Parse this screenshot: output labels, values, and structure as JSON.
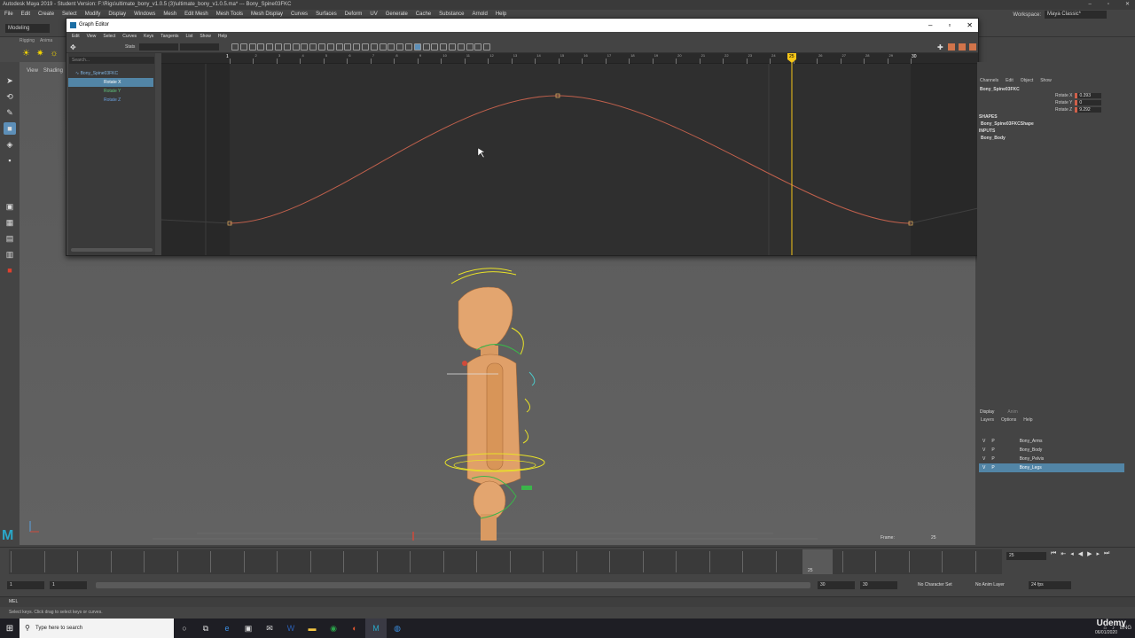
{
  "app": {
    "title": "Autodesk Maya 2019 - Student Version: F:\\Rigs\\ultimate_bony_v1.0.5 (3)\\ultimate_bony_v1.0.5.ma* --- Bony_Spine03FKC",
    "menus": [
      "File",
      "Edit",
      "Create",
      "Select",
      "Modify",
      "Display",
      "Windows",
      "Mesh",
      "Edit Mesh",
      "Mesh Tools",
      "Mesh Display",
      "Curves",
      "Surfaces",
      "Deform",
      "UV",
      "Generate",
      "Cache",
      "Substance",
      "Arnold",
      "Help"
    ],
    "workspace_label": "Workspace:",
    "workspace_value": "Maya Classic*",
    "mode": "Modeling",
    "shelf_tabs": [
      "Rigging",
      "Anima"
    ]
  },
  "viewport": {
    "menu": [
      "View",
      "Shading"
    ],
    "frame_label": "Frame:",
    "frame_value": "25"
  },
  "graph_editor": {
    "title": "Graph Editor",
    "menu": [
      "Edit",
      "View",
      "Select",
      "Curves",
      "Keys",
      "Tangents",
      "List",
      "Show",
      "Help"
    ],
    "stats_label": "Stats",
    "search_placeholder": "Search...",
    "outliner": {
      "root": "Bony_Spine03FKC",
      "items": [
        "Rotate X",
        "Rotate Y",
        "Rotate Z"
      ]
    },
    "current_frame": "25",
    "end_frame": "30",
    "start_frame": "1",
    "ruler_ticks": [
      "1",
      "2",
      "3",
      "4",
      "5",
      "6",
      "7",
      "8",
      "9",
      "10",
      "11",
      "12",
      "13",
      "14",
      "15",
      "16",
      "17",
      "18",
      "19",
      "20",
      "21",
      "22",
      "23",
      "24",
      "25",
      "26",
      "27",
      "28",
      "29",
      "30"
    ],
    "curve_color": "#c0604c",
    "playhead_color": "#f5c518"
  },
  "channel_box": {
    "menu": [
      "Channels",
      "Edit",
      "Object",
      "Show"
    ],
    "object": "Bony_Spine03FKC",
    "attrs": [
      {
        "name": "Rotate X",
        "value": "0.393"
      },
      {
        "name": "Rotate Y",
        "value": "0"
      },
      {
        "name": "Rotate Z",
        "value": "9.292"
      }
    ],
    "shapes_header": "SHAPES",
    "shape": "Bony_Spine03FKCShape",
    "inputs_header": "INPUTS",
    "input": "Bony_Body"
  },
  "layer_editor": {
    "tabs": [
      "Display",
      "Anim"
    ],
    "menu": [
      "Layers",
      "Options",
      "Help"
    ],
    "layers": [
      {
        "v": "V",
        "p": "P",
        "name": "Bony_Arms"
      },
      {
        "v": "V",
        "p": "P",
        "name": "Bony_Body"
      },
      {
        "v": "V",
        "p": "P",
        "name": "Bony_Pelvis"
      },
      {
        "v": "V",
        "p": "P",
        "name": "Bony_Legs"
      }
    ]
  },
  "time": {
    "current": "25",
    "range_start": "1",
    "range_start2": "1",
    "range_end": "30",
    "range_end2": "30",
    "character_set": "No Character Set",
    "anim_layer": "No Anim Layer",
    "fps": "24 fps",
    "mel_label": "MEL",
    "help": "Select keys. Click drag to select keys or curves."
  },
  "taskbar": {
    "search_placeholder": "Type here to search",
    "language": "ENG",
    "date": "06/01/2020",
    "watermark": "Udemy"
  }
}
